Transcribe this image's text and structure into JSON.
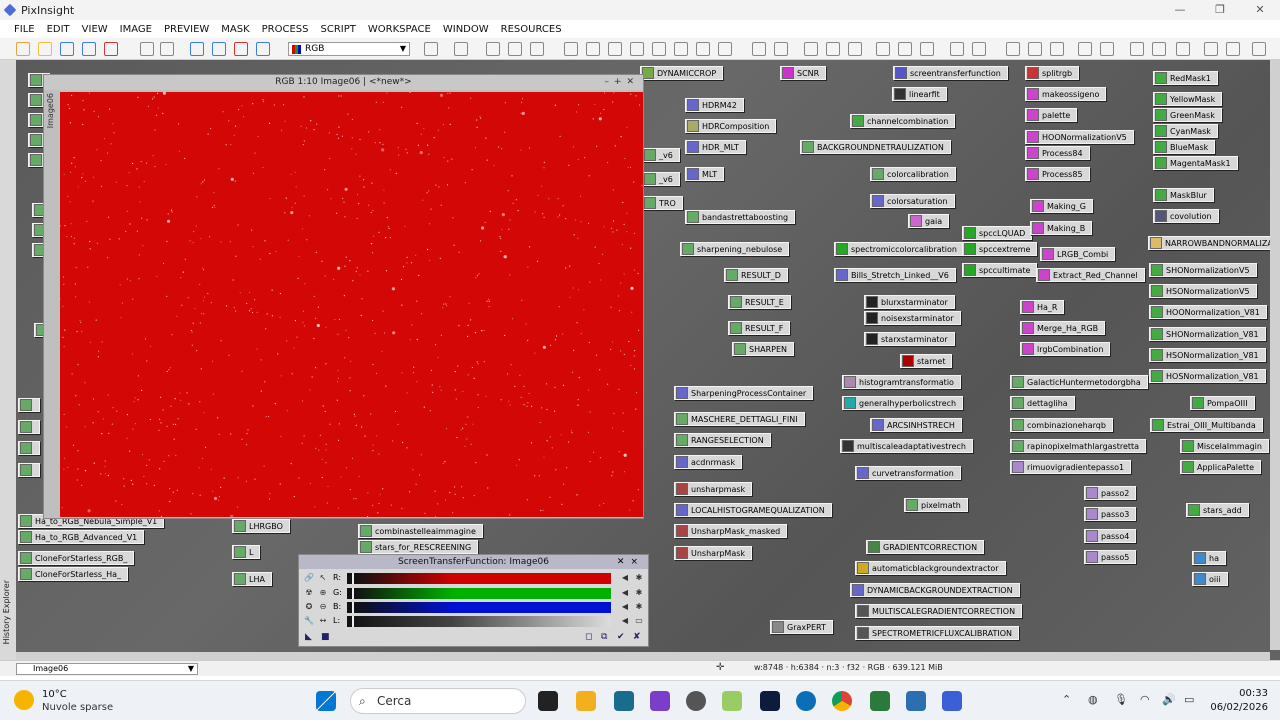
{
  "app": {
    "title": "PixInsight"
  },
  "menu": [
    "FILE",
    "EDIT",
    "VIEW",
    "IMAGE",
    "PREVIEW",
    "MASK",
    "PROCESS",
    "SCRIPT",
    "WORKSPACE",
    "WINDOW",
    "RESOURCES"
  ],
  "toolbar": {
    "rgb_select": "RGB"
  },
  "image_window": {
    "title": "RGB 1:10 Image06 | <*new*>",
    "side_tab": "Image06",
    "background_color": "#d40707"
  },
  "left_strip": {
    "label": "History Explorer"
  },
  "process_icons": [
    {
      "label": "DYNAMICCROP",
      "color": "#7a4"
    },
    {
      "label": "SCNR",
      "color": "#c3c"
    },
    {
      "label": "screentransferfunction",
      "color": "#55c"
    },
    {
      "label": "splitrgb",
      "color": "#c33"
    },
    {
      "label": "RedMask1",
      "color": "#4a4"
    },
    {
      "label": "linearfit",
      "color": "#333"
    },
    {
      "label": "makeossigeno",
      "color": "#c4c"
    },
    {
      "label": "YellowMask",
      "color": "#4a4"
    },
    {
      "label": "HDRM42",
      "color": "#66c"
    },
    {
      "label": "GreenMask",
      "color": "#4a4"
    },
    {
      "label": "palette",
      "color": "#c4c"
    },
    {
      "label": "HDRComposition",
      "color": "#aa6"
    },
    {
      "label": "channelcombination",
      "color": "#4a4"
    },
    {
      "label": "CyanMask",
      "color": "#4a4"
    },
    {
      "label": "HOONormalizationV5",
      "color": "#c4c"
    },
    {
      "label": "BlueMask",
      "color": "#4a4"
    },
    {
      "label": "HDR_MLT",
      "color": "#66c"
    },
    {
      "label": "BACKGROUNDNETRAULIZATION",
      "color": "#6a6"
    },
    {
      "label": "Process84",
      "color": "#c4c"
    },
    {
      "label": "MagentaMask1",
      "color": "#4a4"
    },
    {
      "label": "MLT",
      "color": "#66c"
    },
    {
      "label": "colorcalibration",
      "color": "#6a6"
    },
    {
      "label": "Process85",
      "color": "#c4c"
    },
    {
      "label": "MaskBlur",
      "color": "#4a4"
    },
    {
      "label": "colorsaturation",
      "color": "#66c"
    },
    {
      "label": "Making_G",
      "color": "#c4c"
    },
    {
      "label": "covolution",
      "color": "#557"
    },
    {
      "label": "bandastrettaboosting",
      "color": "#6a6"
    },
    {
      "label": "gaia",
      "color": "#c6c"
    },
    {
      "label": "spccLQUAD",
      "color": "#2a2"
    },
    {
      "label": "Making_B",
      "color": "#c4c"
    },
    {
      "label": "NARROWBANDNORMALIZA",
      "color": "#db6"
    },
    {
      "label": "sharpening_nebulose",
      "color": "#6a6"
    },
    {
      "label": "spectromiccolorcalibration",
      "color": "#2a2"
    },
    {
      "label": "spccextreme",
      "color": "#2a2"
    },
    {
      "label": "LRGB_Combi",
      "color": "#c4c"
    },
    {
      "label": "SHONormalizationV5",
      "color": "#4a4"
    },
    {
      "label": "RESULT_D",
      "color": "#6a6"
    },
    {
      "label": "Bills_Stretch_Linked__V6",
      "color": "#66c"
    },
    {
      "label": "spccultimate",
      "color": "#2a2"
    },
    {
      "label": "Extract_Red_Channel",
      "color": "#c4c"
    },
    {
      "label": "HSONormalizationV5",
      "color": "#4a4"
    },
    {
      "label": "RESULT_E",
      "color": "#6a6"
    },
    {
      "label": "blurxstarminator",
      "color": "#222"
    },
    {
      "label": "Ha_R",
      "color": "#c4c"
    },
    {
      "label": "HOONormalization_V81",
      "color": "#4a4"
    },
    {
      "label": "noisexstarminator",
      "color": "#222"
    },
    {
      "label": "RESULT_F",
      "color": "#6a6"
    },
    {
      "label": "Merge_Ha_RGB",
      "color": "#c4c"
    },
    {
      "label": "SHONormalization_V81",
      "color": "#4a4"
    },
    {
      "label": "starxstarminator",
      "color": "#222"
    },
    {
      "label": "SHARPEN",
      "color": "#6a6"
    },
    {
      "label": "lrgbCombination",
      "color": "#c4c"
    },
    {
      "label": "HSONormalization_V81",
      "color": "#4a4"
    },
    {
      "label": "starnet",
      "color": "#a00"
    },
    {
      "label": "HOSNormalization_V81",
      "color": "#4a4"
    },
    {
      "label": "histogramtransformatio",
      "color": "#a8a"
    },
    {
      "label": "GalacticHuntermetodorgbha",
      "color": "#6a6"
    },
    {
      "label": "SharpeningProcessContainer",
      "color": "#66c"
    },
    {
      "label": "generalhyperbolicstrech",
      "color": "#2aa"
    },
    {
      "label": "dettagliha",
      "color": "#6a6"
    },
    {
      "label": "PompaOIII",
      "color": "#4a4"
    },
    {
      "label": "MASCHERE_DETTAGLI_FINI",
      "color": "#6a6"
    },
    {
      "label": "ARCSINHSTRECH",
      "color": "#66c"
    },
    {
      "label": "combinazioneharqb",
      "color": "#6a6"
    },
    {
      "label": "Estrai_OIII_Multibanda",
      "color": "#4a4"
    },
    {
      "label": "RANGESELECTION",
      "color": "#6a6"
    },
    {
      "label": "multiscaleadaptativestrech",
      "color": "#333"
    },
    {
      "label": "rapinopixelmathlargastretta",
      "color": "#6a6"
    },
    {
      "label": "MiscelaImmagin",
      "color": "#4a4"
    },
    {
      "label": "acdnrmask",
      "color": "#66c"
    },
    {
      "label": "curvetransformation",
      "color": "#66c"
    },
    {
      "label": "rimuovigradientepasso1",
      "color": "#a8c"
    },
    {
      "label": "ApplicaPalette",
      "color": "#4a4"
    },
    {
      "label": "unsharpmask",
      "color": "#a44"
    },
    {
      "label": "passo2",
      "color": "#a8c"
    },
    {
      "label": "LOCALHISTOGRAMEQUALIZATION",
      "color": "#66c"
    },
    {
      "label": "pixelmath",
      "color": "#6a6"
    },
    {
      "label": "passo3",
      "color": "#a8c"
    },
    {
      "label": "stars_add",
      "color": "#4a4"
    },
    {
      "label": "UnsharpMask_masked",
      "color": "#a44"
    },
    {
      "label": "passo4",
      "color": "#a8c"
    },
    {
      "label": "GRADIENTCORRECTION",
      "color": "#484"
    },
    {
      "label": "UnsharpMask",
      "color": "#a44"
    },
    {
      "label": "passo5",
      "color": "#a8c"
    },
    {
      "label": "automaticblackgroundextractor",
      "color": "#ca2"
    },
    {
      "label": "ha",
      "color": "#48c"
    },
    {
      "label": "DYNAMICBACKGROUNDEXTRACTION",
      "color": "#66c"
    },
    {
      "label": "oiii",
      "color": "#48c"
    },
    {
      "label": "MULTISCALEGRADIENTCORRECTION",
      "color": "#555"
    },
    {
      "label": "GraxPERT",
      "color": "#888"
    },
    {
      "label": "SPECTROMETRICFLUXCALIBRATION",
      "color": "#555"
    },
    {
      "label": "Ha_to_RGB_Nebula_Simple_V1",
      "color": "#6a6"
    },
    {
      "label": "Ha_to_RGB_Advanced_V1",
      "color": "#6a6"
    },
    {
      "label": "CloneForStarless_RGB_",
      "color": "#6a6"
    },
    {
      "label": "CloneForStarless_Ha_",
      "color": "#6a6"
    },
    {
      "label": "LHRGBO",
      "color": "#6a6"
    },
    {
      "label": "L",
      "color": "#6a6"
    },
    {
      "label": "LHA",
      "color": "#6a6"
    },
    {
      "label": "combinastelleaimmagine",
      "color": "#6a6"
    },
    {
      "label": "stars_for_RESCREENING",
      "color": "#6a6"
    },
    {
      "label": "_v6",
      "color": "#6a6"
    },
    {
      "label": "_v6",
      "color": "#6a6"
    },
    {
      "label": "TRO",
      "color": "#6a6"
    }
  ],
  "stf_dialog": {
    "title": "ScreenTransferFunction: Image06",
    "rows": [
      {
        "label": "R:",
        "color": "#d00000"
      },
      {
        "label": "G:",
        "color": "#00b000"
      },
      {
        "label": "B:",
        "color": "#0010d0"
      },
      {
        "label": "L:",
        "color": "#d8d8d8"
      }
    ]
  },
  "status": {
    "view_select": "Image06",
    "info": "w:8748 · h:6384 · n:3 · f32 · RGB · 639.121 MiB"
  },
  "taskbar": {
    "temperature": "10°C",
    "weather": "Nuvole sparse",
    "search": "Cerca",
    "time": "00:33",
    "date": "06/02/2026"
  }
}
